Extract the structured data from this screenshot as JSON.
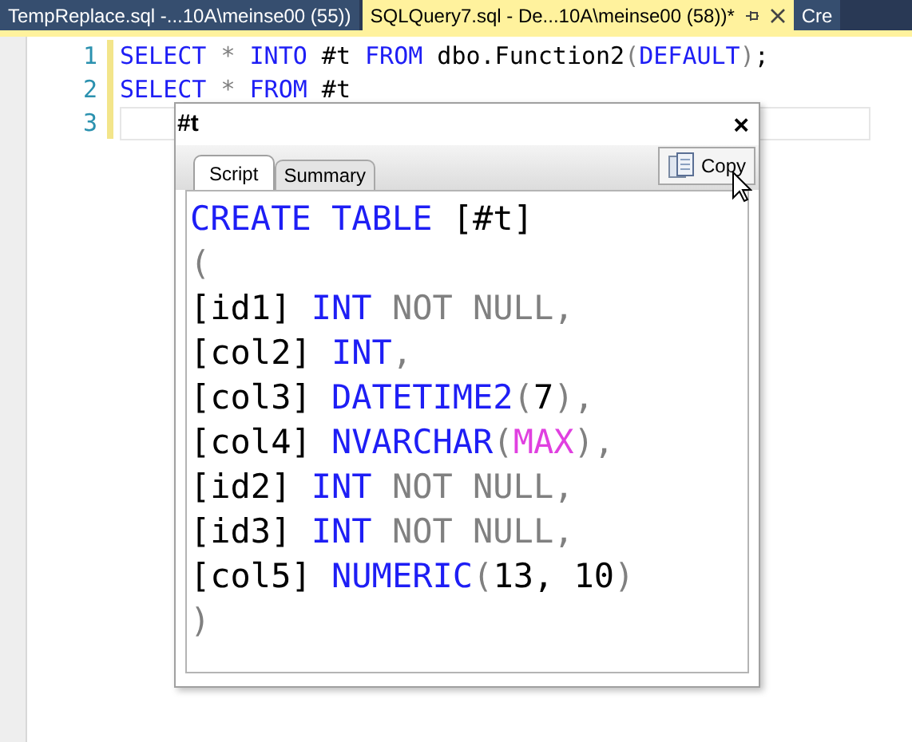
{
  "document_tabs": [
    {
      "title": "TempReplace.sql -...10A\\meinse00 (55))",
      "selected": false
    },
    {
      "title": "SQLQuery7.sql - De...10A\\meinse00 (58))*",
      "selected": true
    },
    {
      "title": "Cre",
      "selected": false
    }
  ],
  "editor": {
    "lines": [
      {
        "number": "1",
        "current": false,
        "tokens": [
          {
            "kind": "keyword",
            "text": "SELECT"
          },
          {
            "kind": "operator",
            "text": " * "
          },
          {
            "kind": "keyword",
            "text": "INTO"
          },
          {
            "kind": "plain",
            "text": " #t "
          },
          {
            "kind": "keyword",
            "text": "FROM"
          },
          {
            "kind": "plain",
            "text": " dbo.Function2"
          },
          {
            "kind": "operator",
            "text": "("
          },
          {
            "kind": "keyword",
            "text": "DEFAULT"
          },
          {
            "kind": "operator",
            "text": ")"
          },
          {
            "kind": "plain",
            "text": ";"
          }
        ]
      },
      {
        "number": "2",
        "current": false,
        "tokens": [
          {
            "kind": "keyword",
            "text": "SELECT"
          },
          {
            "kind": "operator",
            "text": " * "
          },
          {
            "kind": "keyword",
            "text": "FROM"
          },
          {
            "kind": "plain",
            "text": " #t"
          }
        ]
      },
      {
        "number": "3",
        "current": true
      }
    ]
  },
  "popup": {
    "title": "#t",
    "close": "×",
    "tabs": [
      {
        "label": "Script",
        "selected": true
      },
      {
        "label": "Summary",
        "selected": false
      }
    ],
    "copy_button": "Copy",
    "script_lines": [
      [
        {
          "kind": "keyword",
          "text": "CREATE TABLE"
        },
        {
          "kind": "plain",
          "text": " [#t]"
        }
      ],
      [
        {
          "kind": "operator",
          "text": "("
        }
      ],
      [
        {
          "kind": "plain",
          "text": "[id1] "
        },
        {
          "kind": "keyword",
          "text": "INT"
        },
        {
          "kind": "operator",
          "text": " NOT NULL,"
        }
      ],
      [
        {
          "kind": "plain",
          "text": "[col2] "
        },
        {
          "kind": "keyword",
          "text": "INT"
        },
        {
          "kind": "operator",
          "text": ","
        }
      ],
      [
        {
          "kind": "plain",
          "text": "[col3] "
        },
        {
          "kind": "keyword",
          "text": "DATETIME2"
        },
        {
          "kind": "operator",
          "text": "("
        },
        {
          "kind": "plain",
          "text": "7"
        },
        {
          "kind": "operator",
          "text": "),"
        }
      ],
      [
        {
          "kind": "plain",
          "text": "[col4] "
        },
        {
          "kind": "keyword",
          "text": "NVARCHAR"
        },
        {
          "kind": "operator",
          "text": "("
        },
        {
          "kind": "function",
          "text": "MAX"
        },
        {
          "kind": "operator",
          "text": "),"
        }
      ],
      [
        {
          "kind": "plain",
          "text": "[id2] "
        },
        {
          "kind": "keyword",
          "text": "INT"
        },
        {
          "kind": "operator",
          "text": " NOT NULL,"
        }
      ],
      [
        {
          "kind": "plain",
          "text": "[id3] "
        },
        {
          "kind": "keyword",
          "text": "INT"
        },
        {
          "kind": "operator",
          "text": " NOT NULL,"
        }
      ],
      [
        {
          "kind": "plain",
          "text": "[col5] "
        },
        {
          "kind": "keyword",
          "text": "NUMERIC"
        },
        {
          "kind": "operator",
          "text": "("
        },
        {
          "kind": "plain",
          "text": "13, 10"
        },
        {
          "kind": "operator",
          "text": ")"
        }
      ],
      [
        {
          "kind": "operator",
          "text": ")"
        }
      ]
    ]
  }
}
